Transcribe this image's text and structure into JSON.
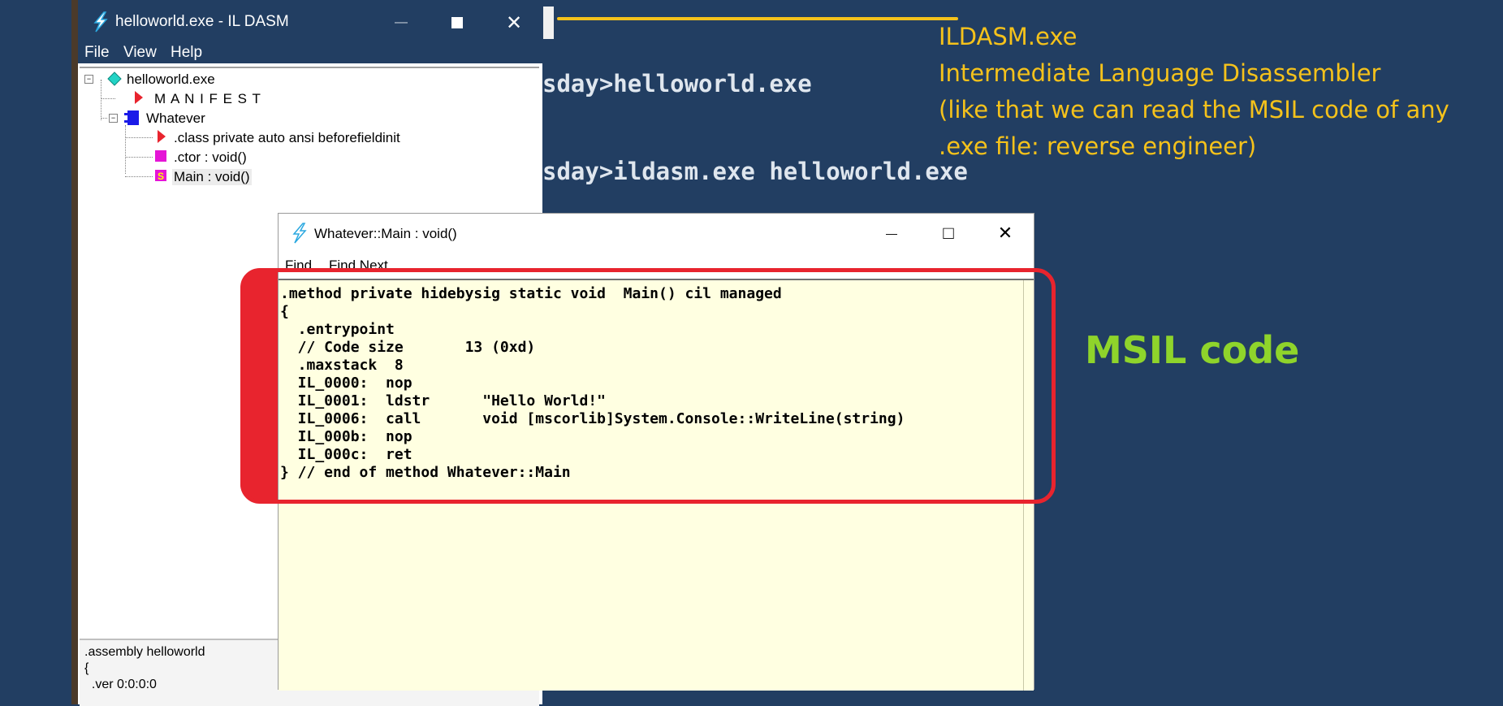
{
  "console": {
    "line1": "sday>helloworld.exe",
    "line2": "sday>ildasm.exe helloworld.exe"
  },
  "annotations": {
    "line1": "ILDASM.exe",
    "line2": "Intermediate Language Disassembler",
    "line3": "(like that we can read the MSIL code of any",
    "line4": ".exe file:  reverse engineer)",
    "msil_label": "MSIL code",
    "colors": {
      "annotation": "#f5c21b",
      "msil_label": "#8fd42b",
      "highlight": "#e8242e"
    }
  },
  "main_window": {
    "title": "helloworld.exe - IL DASM",
    "icons": {
      "app": "ildasm-lightning-icon",
      "minimize": "minimize-icon",
      "maximize": "maximize-icon",
      "close": "close-icon"
    },
    "caption": {
      "minimize": "—",
      "maximize": "□",
      "close": "✕"
    },
    "menu": [
      "File",
      "View",
      "Help"
    ],
    "tree": {
      "root": "helloworld.exe",
      "manifest": "M A N I F E S T",
      "class_name": "Whatever",
      "class_decl": ".class private auto ansi beforefieldinit",
      "ctor": ".ctor : void()",
      "main": "Main : void()",
      "expander_minus": "−"
    },
    "bottom_pane": [
      ".assembly helloworld",
      "{",
      "  .ver 0:0:0:0"
    ]
  },
  "method_window": {
    "title": "Whatever::Main : void()",
    "caption": {
      "minimize": "—",
      "maximize": "□",
      "close": "✕"
    },
    "menu": [
      "Find",
      "Find Next"
    ],
    "code": [
      ".method private hidebysig static void  Main() cil managed",
      "{",
      "  .entrypoint",
      "  // Code size       13 (0xd)",
      "  .maxstack  8",
      "  IL_0000:  nop",
      "  IL_0001:  ldstr      \"Hello World!\"",
      "  IL_0006:  call       void [mscorlib]System.Console::WriteLine(string)",
      "  IL_000b:  nop",
      "  IL_000c:  ret",
      "} // end of method Whatever::Main"
    ]
  }
}
